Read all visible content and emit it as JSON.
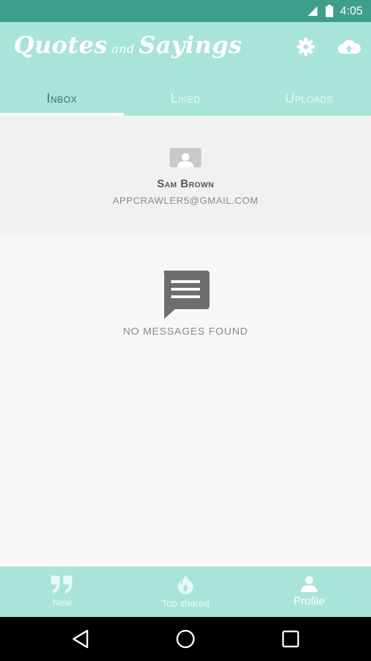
{
  "status_bar": {
    "time": "4:05"
  },
  "header": {
    "title_part1": "Quotes",
    "title_connector": "and",
    "title_part2": "Sayings",
    "settings_icon": "gear-icon",
    "upload_icon": "cloud-upload-icon"
  },
  "tabs": [
    {
      "label": "Inbox",
      "active": true
    },
    {
      "label": "Liked",
      "active": false
    },
    {
      "label": "Uploads",
      "active": false
    }
  ],
  "profile": {
    "name": "Sam Brown",
    "email": "APPCRAWLER5@GMAIL.COM",
    "avatar_icon": "user-placeholder-icon"
  },
  "empty_state": {
    "icon": "message-icon",
    "text": "NO MESSAGES FOUND"
  },
  "bottom_nav": [
    {
      "label": "New",
      "icon": "quote-icon",
      "active": false
    },
    {
      "label": "Top shared",
      "icon": "flame-icon",
      "active": false
    },
    {
      "label": "Profile",
      "icon": "person-icon",
      "active": true
    }
  ],
  "colors": {
    "status_bar": "#3d9e8c",
    "header": "#a9e4d8",
    "active_tab_text": "#3f6f66",
    "background": "#f7f7f7",
    "card": "#f1f1f1"
  }
}
